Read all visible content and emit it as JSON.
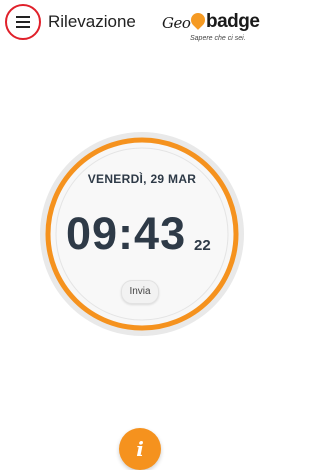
{
  "header": {
    "title": "Rilevazione",
    "menu_icon": "hamburger-menu-icon",
    "logo": {
      "geo": "Geo",
      "badge": "badge",
      "tagline": "Sapere che ci sei."
    }
  },
  "clock": {
    "date": "VENERDÌ, 29 MAR",
    "time": "09:43",
    "seconds": "22",
    "send_label": "Invia"
  },
  "info_button": {
    "label": "i",
    "icon": "info-icon"
  },
  "colors": {
    "accent": "#f5921e",
    "menu_highlight": "#e0202a",
    "clock_text": "#2e3a47"
  }
}
